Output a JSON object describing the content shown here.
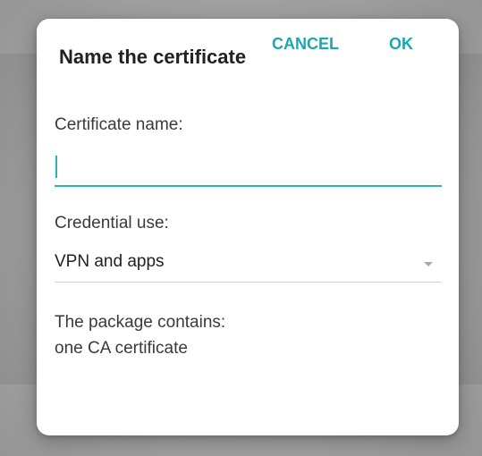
{
  "dialog": {
    "title": "Name the certificate",
    "certificate_name_label": "Certificate name:",
    "certificate_name": {
      "value": "",
      "placeholder": ""
    },
    "credential_use_label": "Credential use:",
    "credential_use": {
      "selected": "VPN and apps"
    },
    "package_info_line1": "The package contains:",
    "package_info_line2": "one CA certificate",
    "cancel_label": "CANCEL",
    "ok_label": "OK"
  },
  "colors": {
    "accent": "#2ab3b8",
    "button_text": "#1aa8b0",
    "dialog_background": "#ffffff",
    "scrim": "#9c9c9c"
  },
  "icons": {
    "dropdown": "dropdown-arrow-icon",
    "caret": "text-cursor"
  }
}
